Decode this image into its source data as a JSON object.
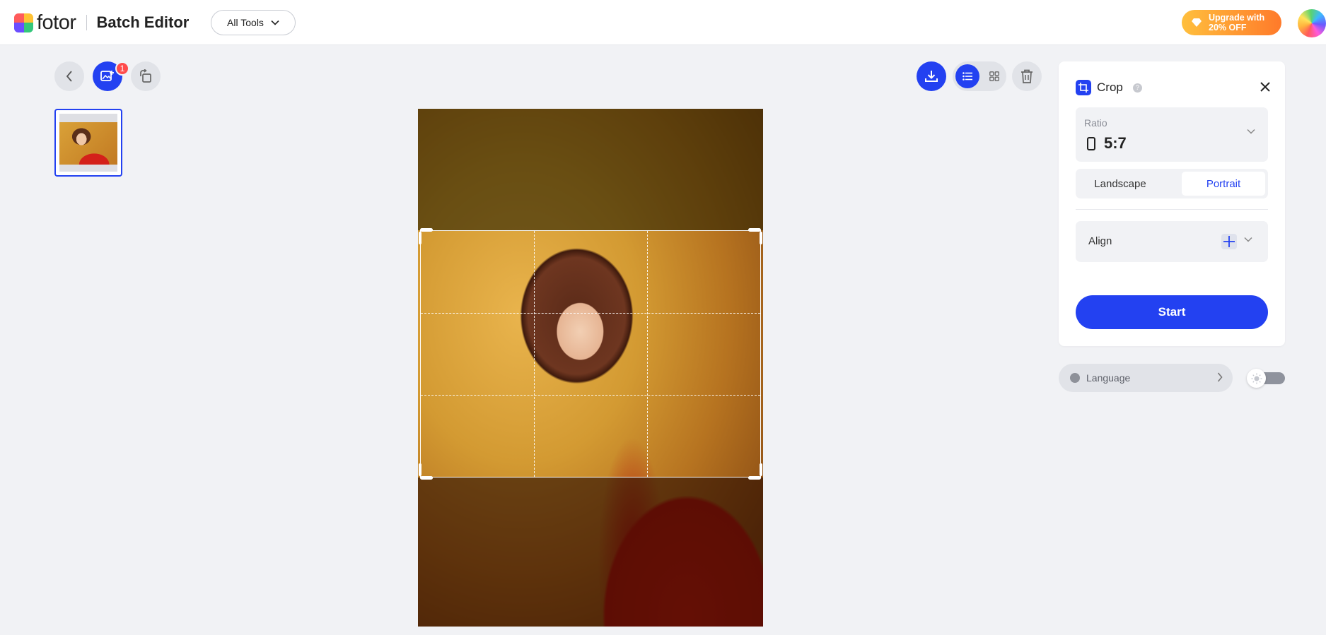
{
  "header": {
    "brand": "fotor",
    "product": "Batch Editor",
    "all_tools_label": "All Tools",
    "upgrade_line1": "Upgrade with",
    "upgrade_line2": "20% OFF"
  },
  "toolbar": {
    "upload_badge_count": "1"
  },
  "panel": {
    "title": "Crop",
    "ratio_label": "Ratio",
    "ratio_value": "5:7",
    "orientation": {
      "landscape": "Landscape",
      "portrait": "Portrait",
      "selected": "Portrait"
    },
    "align_label": "Align",
    "start_label": "Start"
  },
  "footer": {
    "language_label": "Language"
  },
  "colors": {
    "accent": "#2341f1",
    "badge": "#ff4b4b",
    "upgrade_from": "#ffbf3d",
    "upgrade_to": "#ff7a2a"
  }
}
